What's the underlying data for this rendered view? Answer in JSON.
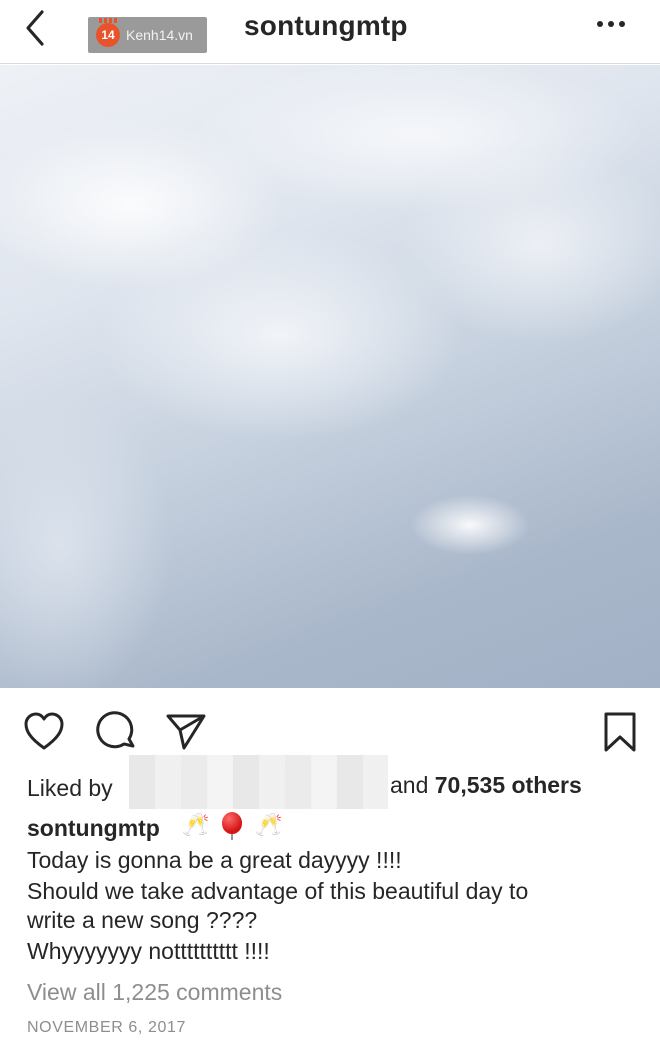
{
  "header": {
    "username": "sontungmtp",
    "watermark_badge": "14",
    "watermark_text": "Kenh14.vn",
    "back_icon": "chevron-left-icon",
    "more_icon": "more-dots-icon"
  },
  "actions": {
    "like_icon": "heart-icon",
    "comment_icon": "comment-bubble-icon",
    "share_icon": "send-icon",
    "save_icon": "bookmark-icon"
  },
  "likes": {
    "prefix": "Liked by",
    "suffix_and": "and",
    "count_text": "70,535 others"
  },
  "caption": {
    "username": "sontungmtp",
    "emojis": [
      "🥂",
      "🎈",
      "🥂"
    ],
    "lines": [
      "Today is gonna be a great dayyyy !!!!",
      "Should we take advantage of this beautiful day to",
      "write a new song ????",
      "Whyyyyyyy notttttttttt !!!!"
    ]
  },
  "comments": {
    "view_all": "View all 1,225 comments"
  },
  "date": "NOVEMBER 6, 2017",
  "colors": {
    "text": "#262626",
    "muted": "#8e8e8e",
    "badge": "#e8532b"
  }
}
